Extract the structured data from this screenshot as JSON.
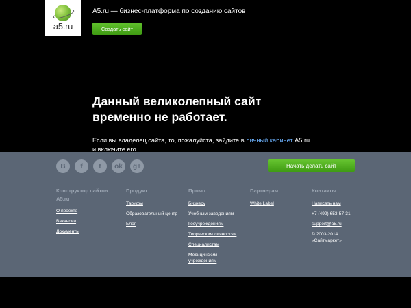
{
  "header": {
    "logo_text": "a5.ru",
    "tagline": "A5.ru — бизнес-платформа по созданию сайтов",
    "create_button": "Создать сайт"
  },
  "main": {
    "headline_line1": "Данный великолепный сайт",
    "headline_line2": "временно не работает.",
    "desc_before": "Если вы владелец сайта, то, пожалуйста, зайдите в ",
    "desc_link": "личный кабинет",
    "desc_after": " A5.ru и включите его"
  },
  "footer": {
    "social_icons": [
      {
        "name": "vk-icon",
        "glyph": "В"
      },
      {
        "name": "facebook-icon",
        "glyph": "f"
      },
      {
        "name": "twitter-icon",
        "glyph": "t"
      },
      {
        "name": "odnoklassniki-icon",
        "glyph": "ok"
      },
      {
        "name": "googleplus-icon",
        "glyph": "g+"
      }
    ],
    "start_button": "Начать делать сайт",
    "columns": {
      "builder": {
        "title": "Конструктор сайтов A5.ru",
        "links": [
          "О проекте",
          "Вакансии",
          "Документы"
        ]
      },
      "product": {
        "title": "Продукт",
        "links": [
          "Тарифы",
          "Образовательный центр",
          "Блог"
        ]
      },
      "promo": {
        "title": "Промо",
        "links": [
          "Бизнесу",
          "Учебным заведениям",
          "Госучреждениям",
          "Творческим личностям",
          "Специалистам",
          "Медицинским учреждениям"
        ]
      },
      "partners": {
        "title": "Партнерам",
        "links": [
          "White Label"
        ]
      },
      "contacts": {
        "title": "Контакты",
        "write_us": "Написать нам",
        "phone": "+7 (499) 653-57-31",
        "email": "support@a5.ru",
        "copyright_line1": "© 2003-2014",
        "copyright_line2": "«Сайтмаркет»"
      }
    }
  },
  "colors": {
    "background": "#000000",
    "footer_bg": "#5b6675",
    "accent_green": "#4caf1f",
    "link_blue": "#6db3ff",
    "column_title": "#9aa4b1"
  }
}
